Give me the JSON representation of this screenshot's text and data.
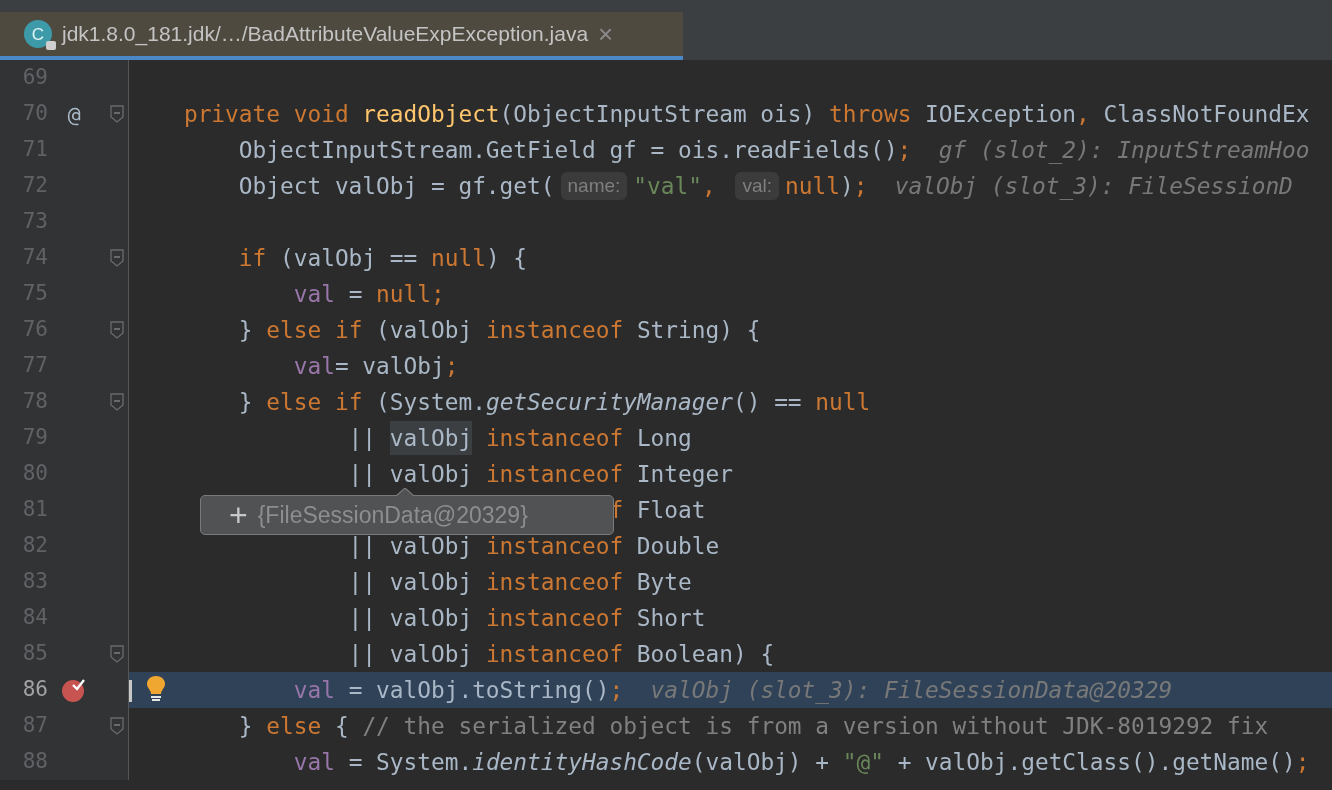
{
  "tab": {
    "icon_letter": "C",
    "title": "jdk1.8.0_181.jdk/…/BadAttributeValueExpException.java",
    "close": "×",
    "selected": true
  },
  "lines": [
    {
      "number": "69",
      "fold": false,
      "breakpoint": false,
      "current": false,
      "bulb": false
    },
    {
      "number": "70",
      "mark": "@",
      "fold": true,
      "breakpoint": false,
      "current": false,
      "bulb": false,
      "tokens": [
        {
          "kind": "kw",
          "text": "    private void "
        },
        {
          "kind": "method",
          "text": "readObject"
        },
        {
          "kind": "plain",
          "text": "(ObjectInputStream ois) "
        },
        {
          "kind": "kw",
          "text": "throws "
        },
        {
          "kind": "plain",
          "text": "IOException"
        },
        {
          "kind": "kw",
          "text": ", "
        },
        {
          "kind": "plain",
          "text": "ClassNotFoundEx"
        }
      ]
    },
    {
      "number": "71",
      "fold": false,
      "breakpoint": false,
      "current": false,
      "bulb": false,
      "tokens": [
        {
          "kind": "plain",
          "text": "        ObjectInputStream.GetField gf = ois.readFields()"
        },
        {
          "kind": "kw",
          "text": ";"
        },
        {
          "kind": "inline",
          "text": "  gf (slot_2): InputStreamHoo"
        }
      ]
    },
    {
      "number": "72",
      "fold": false,
      "breakpoint": false,
      "current": false,
      "bulb": false,
      "tokens": [
        {
          "kind": "plain",
          "text": "        Object valObj = gf.get("
        },
        {
          "kind": "hint",
          "text": "name:"
        },
        {
          "kind": "str",
          "text": "\"val\""
        },
        {
          "kind": "kw",
          "text": ", "
        },
        {
          "kind": "hint",
          "text": "val:"
        },
        {
          "kind": "kw",
          "text": "null"
        },
        {
          "kind": "plain",
          "text": ")"
        },
        {
          "kind": "kw",
          "text": ";"
        },
        {
          "kind": "inline",
          "text": "  valObj (slot_3): FileSessionD"
        }
      ]
    },
    {
      "number": "73",
      "fold": false,
      "breakpoint": false,
      "current": false,
      "bulb": false
    },
    {
      "number": "74",
      "fold": true,
      "breakpoint": false,
      "current": false,
      "bulb": false,
      "tokens": [
        {
          "kind": "kw",
          "text": "        if "
        },
        {
          "kind": "plain",
          "text": "(valObj == "
        },
        {
          "kind": "kw",
          "text": "null"
        },
        {
          "kind": "plain",
          "text": ") {"
        }
      ]
    },
    {
      "number": "75",
      "fold": false,
      "breakpoint": false,
      "current": false,
      "bulb": false,
      "tokens": [
        {
          "kind": "field",
          "text": "            val"
        },
        {
          "kind": "plain",
          "text": " = "
        },
        {
          "kind": "kw",
          "text": "null;"
        }
      ]
    },
    {
      "number": "76",
      "fold": true,
      "breakpoint": false,
      "current": false,
      "bulb": false,
      "tokens": [
        {
          "kind": "plain",
          "text": "        } "
        },
        {
          "kind": "kw",
          "text": "else if "
        },
        {
          "kind": "plain",
          "text": "(valObj "
        },
        {
          "kind": "kw",
          "text": "instanceof "
        },
        {
          "kind": "plain",
          "text": "String) {"
        }
      ]
    },
    {
      "number": "77",
      "fold": false,
      "breakpoint": false,
      "current": false,
      "bulb": false,
      "tokens": [
        {
          "kind": "field",
          "text": "            val"
        },
        {
          "kind": "plain",
          "text": "= valObj"
        },
        {
          "kind": "kw",
          "text": ";"
        }
      ]
    },
    {
      "number": "78",
      "fold": true,
      "breakpoint": false,
      "current": false,
      "bulb": false,
      "tokens": [
        {
          "kind": "plain",
          "text": "        } "
        },
        {
          "kind": "kw",
          "text": "else if "
        },
        {
          "kind": "plain",
          "text": "(System."
        },
        {
          "kind": "italic",
          "text": "getSecurityManager"
        },
        {
          "kind": "plain",
          "text": "() == "
        },
        {
          "kind": "kw",
          "text": "null"
        }
      ]
    },
    {
      "number": "79",
      "fold": false,
      "breakpoint": false,
      "current": false,
      "bulb": false,
      "tokens": [
        {
          "kind": "plain",
          "text": "                || "
        },
        {
          "kind": "sel",
          "text": "valObj"
        },
        {
          "kind": "kw",
          "text": " instanceof"
        },
        {
          "kind": "plain",
          "text": " Long"
        }
      ]
    },
    {
      "number": "80",
      "fold": false,
      "breakpoint": false,
      "current": false,
      "bulb": false,
      "tokens": [
        {
          "kind": "plain",
          "text": "                || valObj "
        },
        {
          "kind": "kw",
          "text": "instanceof "
        },
        {
          "kind": "plain",
          "text": "Integer"
        }
      ]
    },
    {
      "number": "81",
      "fold": false,
      "breakpoint": false,
      "current": false,
      "bulb": false,
      "tokens": [
        {
          "kind": "kw",
          "text": "                                   f"
        },
        {
          "kind": "plain",
          "text": " Float"
        }
      ]
    },
    {
      "number": "82",
      "fold": false,
      "breakpoint": false,
      "current": false,
      "bulb": false,
      "tokens": [
        {
          "kind": "plain",
          "text": "                || valObj "
        },
        {
          "kind": "kw",
          "text": "instanceof "
        },
        {
          "kind": "plain",
          "text": "Double"
        }
      ]
    },
    {
      "number": "83",
      "fold": false,
      "breakpoint": false,
      "current": false,
      "bulb": false,
      "tokens": [
        {
          "kind": "plain",
          "text": "                || valObj "
        },
        {
          "kind": "kw",
          "text": "instanceof "
        },
        {
          "kind": "plain",
          "text": "Byte"
        }
      ]
    },
    {
      "number": "84",
      "fold": false,
      "breakpoint": false,
      "current": false,
      "bulb": false,
      "tokens": [
        {
          "kind": "plain",
          "text": "                || valObj "
        },
        {
          "kind": "kw",
          "text": "instanceof "
        },
        {
          "kind": "plain",
          "text": "Short"
        }
      ]
    },
    {
      "number": "85",
      "fold": true,
      "breakpoint": false,
      "current": false,
      "bulb": false,
      "tokens": [
        {
          "kind": "plain",
          "text": "                || valObj "
        },
        {
          "kind": "kw",
          "text": "instanceof "
        },
        {
          "kind": "plain",
          "text": "Boolean) {"
        }
      ]
    },
    {
      "number": "86",
      "fold": false,
      "breakpoint": true,
      "current": true,
      "bulb": true,
      "tokens": [
        {
          "kind": "field",
          "text": "            val"
        },
        {
          "kind": "plain",
          "text": " = valObj.toString()"
        },
        {
          "kind": "kw",
          "text": ";"
        },
        {
          "kind": "inline",
          "text": "  valObj (slot_3): FileSessionData@20329"
        }
      ]
    },
    {
      "number": "87",
      "fold": true,
      "breakpoint": false,
      "current": false,
      "bulb": false,
      "tokens": [
        {
          "kind": "plain",
          "text": "        } "
        },
        {
          "kind": "kw",
          "text": "else "
        },
        {
          "kind": "plain",
          "text": "{ "
        },
        {
          "kind": "comment",
          "text": "// the serialized object is from a version without JDK-8019292 fix"
        }
      ]
    },
    {
      "number": "88",
      "fold": false,
      "breakpoint": false,
      "current": false,
      "bulb": false,
      "tokens": [
        {
          "kind": "field",
          "text": "            val"
        },
        {
          "kind": "plain",
          "text": " = System."
        },
        {
          "kind": "italic",
          "text": "identityHashCode"
        },
        {
          "kind": "plain",
          "text": "(valObj) + "
        },
        {
          "kind": "str",
          "text": "\"@\""
        },
        {
          "kind": "plain",
          "text": " + valObj.getClass().getName()"
        },
        {
          "kind": "kw",
          "text": ";"
        }
      ]
    }
  ],
  "tooltip": {
    "expand": "+",
    "value": "{FileSessionData@20329}"
  }
}
